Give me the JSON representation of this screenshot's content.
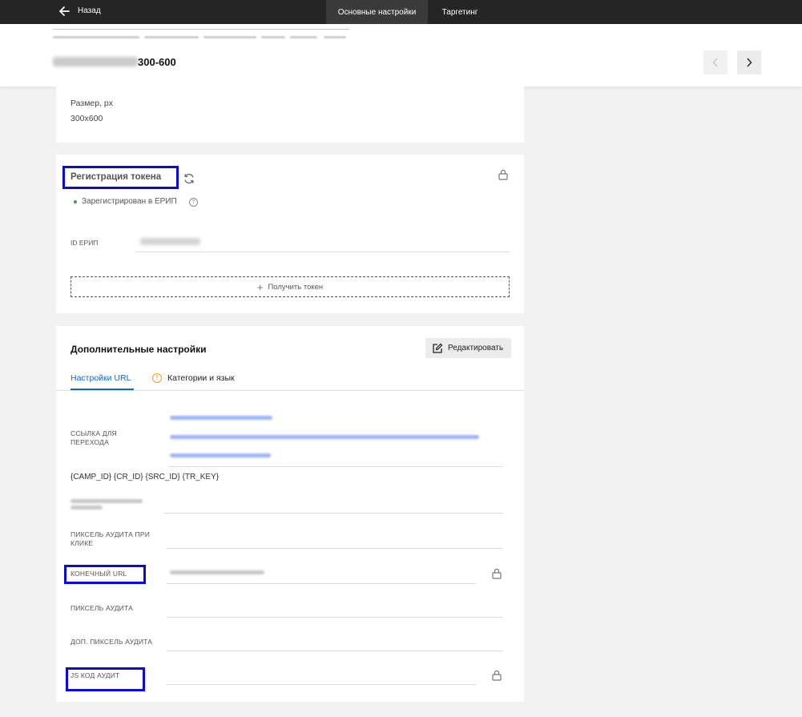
{
  "topbar": {
    "back_label": "Назад",
    "tabs": [
      {
        "label": "Основные настройки",
        "active": true
      },
      {
        "label": "Таргетинг",
        "active": false
      }
    ]
  },
  "header": {
    "title_suffix": "300-600"
  },
  "size_card": {
    "label": "Размер, px",
    "value": "300x600"
  },
  "token_card": {
    "title": "Регистрация токена",
    "status": "Зарегистрирован в ЕРИП",
    "status_color": "#2eaa3a",
    "id_label": "ID ЕРИП",
    "get_token_label": "Получить токен"
  },
  "extra_card": {
    "title": "Дополнительные настройки",
    "edit_label": "Редактировать",
    "tabs": [
      {
        "label": "Настройки URL",
        "active": true
      },
      {
        "label": "Категории и язык",
        "active": false,
        "icon": "warning-icon"
      }
    ],
    "accent_color": "#1565c0",
    "fields": {
      "link_label": "ССЫЛКА ДЛЯ ПЕРЕХОДА",
      "macros": "{CAMP_ID} {CR_ID} {SRC_ID} {TR_KEY}",
      "click_pixel_label": "ПИКСЕЛЬ АУДИТА ПРИ КЛИКЕ",
      "final_url_label": "КОНЕЧНЫЙ URL",
      "pixel_label": "ПИКСЕЛЬ АУДИТА",
      "extra_pixel_label": "ДОП. ПИКСЕЛЬ АУДИТА",
      "js_label": "JS КОД АУДИТ"
    }
  },
  "highlight_color": "#0a0ad8"
}
